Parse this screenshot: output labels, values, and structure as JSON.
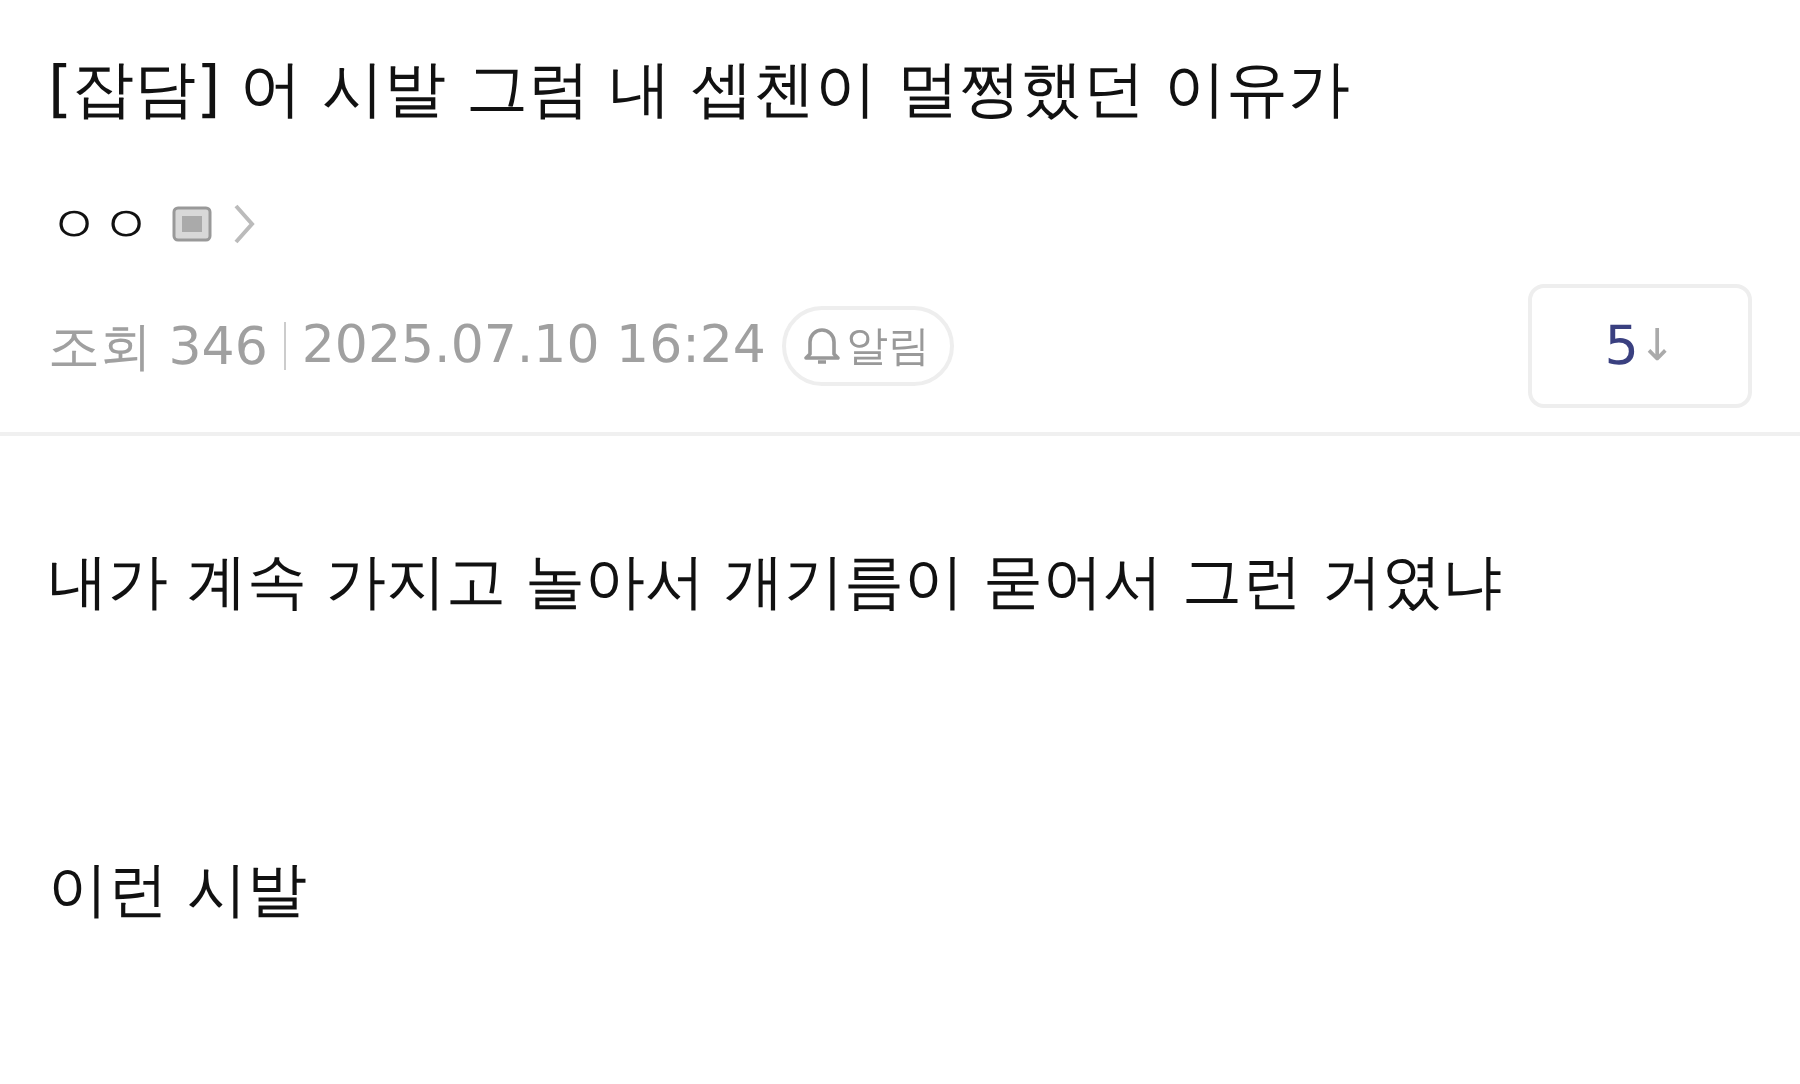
{
  "post": {
    "title": "[잡담] 어 시발 그럼 내 셉첸이 멀쩡했던 이유가",
    "author": "ㅇㅇ",
    "views_label": "조회 346",
    "datetime": "2025.07.10 16:24",
    "alert_button": "알림",
    "comment_count": "5",
    "comment_arrow": "↓"
  },
  "body": [
    "내가 계속 가지고 놀아서 개기름이 묻어서 그런 거였냐",
    "이런 시발"
  ]
}
